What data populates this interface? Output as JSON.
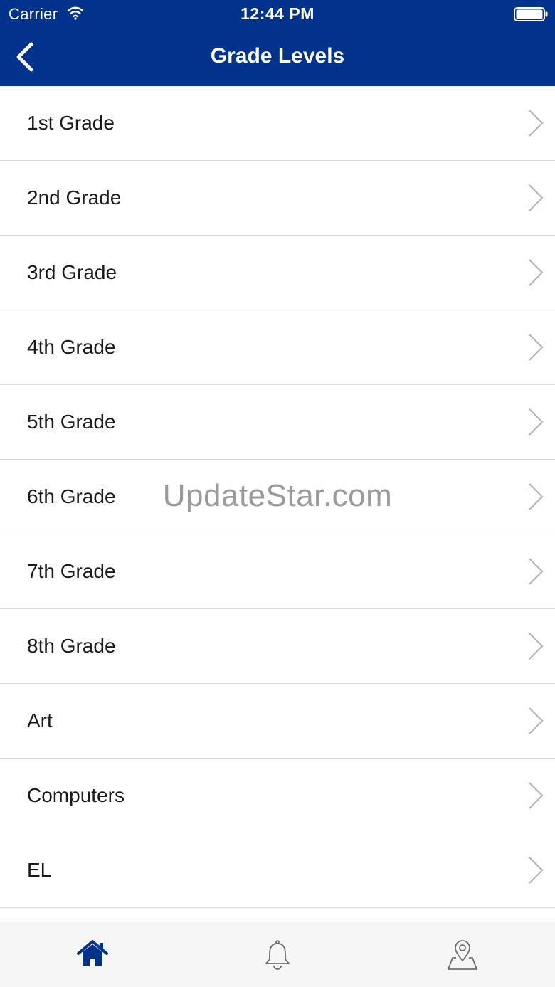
{
  "status_bar": {
    "carrier": "Carrier",
    "time": "12:44 PM"
  },
  "nav": {
    "title": "Grade Levels",
    "back_icon": "chevron-left-icon"
  },
  "list": {
    "items": [
      {
        "label": "1st Grade"
      },
      {
        "label": "2nd Grade"
      },
      {
        "label": "3rd Grade"
      },
      {
        "label": "4th Grade"
      },
      {
        "label": "5th Grade"
      },
      {
        "label": "6th Grade"
      },
      {
        "label": "7th Grade"
      },
      {
        "label": "8th Grade"
      },
      {
        "label": "Art"
      },
      {
        "label": "Computers"
      },
      {
        "label": "EL"
      }
    ]
  },
  "watermark": "UpdateStar.com",
  "tab_bar": {
    "tabs": [
      {
        "icon": "home-icon",
        "active": true
      },
      {
        "icon": "bell-icon",
        "active": false
      },
      {
        "icon": "map-pin-icon",
        "active": false
      }
    ]
  },
  "colors": {
    "brand_blue": "#02338c",
    "chevron_gray": "#b5b5b5",
    "tab_inactive": "#6f6f6f"
  }
}
